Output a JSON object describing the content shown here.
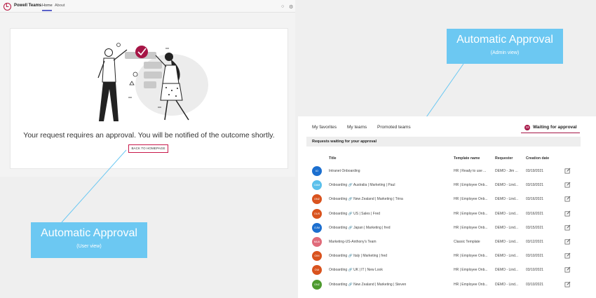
{
  "user_app": {
    "title": "Powell Teams",
    "logo": "L",
    "nav": [
      "Home",
      "About"
    ],
    "message": "Your request requires an approval. You will be notified of the outcome shortly.",
    "back_button": "BACK TO HOMEPAGE"
  },
  "callouts": {
    "user": {
      "title": "Automatic Approval",
      "subtitle": "(User view)"
    },
    "admin": {
      "title": "Automatic Approval",
      "subtitle": "(Admin view)"
    }
  },
  "admin_app": {
    "tabs": [
      "My favorites",
      "My teams",
      "Promoted teams"
    ],
    "waiting_tab": {
      "count": "33",
      "label": "Waiting for approval"
    },
    "section_title": "Requests waiting for your approval",
    "columns": [
      "Title",
      "Template name",
      "Requester",
      "Creation date"
    ],
    "rows": [
      {
        "initials": "IO",
        "color": "#1c6fcf",
        "title": "Intranet Onboarding",
        "template": "HR | Ready to use ...",
        "requester": "DEMO - Jim ...",
        "date": "03/19/2021",
        "icon": false
      },
      {
        "initials": "OAM",
        "color": "#5bc0eb",
        "title": "Onboarding 🔗 Australia | Marketing | Paul",
        "template": "HR | Employee Onb...",
        "requester": "DEMO - Lind...",
        "date": "03/19/2021",
        "icon": true
      },
      {
        "initials": "ONZ",
        "color": "#d9531e",
        "title": "Onboarding 🔗 New Zealand | Marketing | Trina",
        "template": "HR | Employee Onb...",
        "requester": "DEMO - Lind...",
        "date": "03/16/2021",
        "icon": true
      },
      {
        "initials": "OUS",
        "color": "#d9531e",
        "title": "Onboarding 🔗 US | Sales | Fred",
        "template": "HR | Employee Onb...",
        "requester": "DEMO - Lind...",
        "date": "03/16/2021",
        "icon": true
      },
      {
        "initials": "OJM",
        "color": "#1c6fcf",
        "title": "Onboarding 🔗 Japan | Marketing | fred",
        "template": "HR | Employee Onb...",
        "requester": "DEMO - Lind...",
        "date": "03/15/2021",
        "icon": true
      },
      {
        "initials": "MUA",
        "color": "#e06b7a",
        "title": "Marketing-US-Anthony's Team",
        "template": "Classic Template",
        "requester": "DEMO - Lind...",
        "date": "03/12/2021",
        "icon": false
      },
      {
        "initials": "OIM",
        "color": "#d9531e",
        "title": "Onboarding 🔗 Italy | Marketing | fred",
        "template": "HR | Employee Onb...",
        "requester": "DEMO - Lind...",
        "date": "03/10/2021",
        "icon": true
      },
      {
        "initials": "OUI",
        "color": "#d9531e",
        "title": "Onboarding 🔗 UK | IT | New Look",
        "template": "HR | Employee Onb...",
        "requester": "DEMO - Lind...",
        "date": "03/10/2021",
        "icon": true
      },
      {
        "initials": "ONZ",
        "color": "#4e9a2f",
        "title": "Onboarding 🔗 New Zealand | Marketing | Steven",
        "template": "HR | Employee Onb...",
        "requester": "DEMO - Lind...",
        "date": "03/10/2021",
        "icon": true
      }
    ]
  }
}
